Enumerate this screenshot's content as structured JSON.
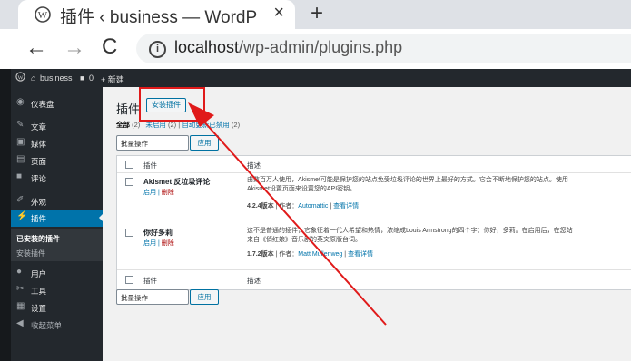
{
  "browser": {
    "tab_title": "插件 ‹ business — WordP",
    "tab_close": "×",
    "new_tab": "+",
    "back": "←",
    "forward": "→",
    "reload": "C",
    "url_host": "localhost",
    "url_path": "/wp-admin/plugins.php"
  },
  "adminbar": {
    "site_name": "business",
    "comments_count": "0",
    "new_label": "+ 新建"
  },
  "sidebar": {
    "items": [
      {
        "icon": "dashboard-icon",
        "label": "仪表盘"
      },
      {
        "icon": "pin-icon",
        "label": "文章"
      },
      {
        "icon": "media-icon",
        "label": "媒体"
      },
      {
        "icon": "page-icon",
        "label": "页面"
      },
      {
        "icon": "comment-icon",
        "label": "评论"
      },
      {
        "icon": "appearance-icon",
        "label": "外观"
      },
      {
        "icon": "plugin-icon",
        "label": "插件"
      },
      {
        "icon": "user-icon",
        "label": "用户"
      },
      {
        "icon": "tools-icon",
        "label": "工具"
      },
      {
        "icon": "settings-icon",
        "label": "设置"
      },
      {
        "icon": "collapse-icon",
        "label": "收起菜单"
      }
    ],
    "submenu": [
      "已安装的插件",
      "安装插件"
    ]
  },
  "main": {
    "title": "插件",
    "add_new": "安装插件",
    "filter_all": "全部",
    "filter_all_count": "(2)",
    "filter_sep1": "|",
    "filter_inactive": "未启用",
    "filter_inactive_count": "(2)",
    "filter_sep2": "|",
    "filter_autoupdate": "自动更新已禁用",
    "filter_autoupdate_count": "(2)",
    "bulk_action": "批量操作",
    "apply": "应用",
    "col_plugin": "插件",
    "col_desc": "描述",
    "plugins": [
      {
        "name": "Akismet 反垃圾评论",
        "activate": "启用",
        "sep": "|",
        "delete": "删除",
        "desc1": "由数百万人使用，Akismet可能是保护您的站点免受垃圾评论的世界上最好的方式。它会不断地保护您的站点。使用",
        "desc2": "Akismet设置页面来设置您的API密钥。",
        "version": "4.2.4版本",
        "author_prefix": "| 作者：",
        "author": "Automattic",
        "meta_sep": "|",
        "details": "查看详情"
      },
      {
        "name": "你好多莉",
        "activate": "启用",
        "sep": "|",
        "delete": "删除",
        "desc1": "这不是普通的插件，它象征着一代人希望和热情，浓缩成Louis Armstrong的四个字：你好，多莉。在启用后，在您站",
        "desc2": "来自《俏红娘》音乐剧的英文原版台词。",
        "version": "1.7.2版本",
        "author_prefix": "| 作者：",
        "author": "Matt Mullenweg",
        "meta_sep": "|",
        "details": "查看详情"
      }
    ]
  },
  "colors": {
    "annotation_red": "#e01a1a",
    "wp_blue": "#0073aa",
    "admin_dark": "#23282d"
  }
}
